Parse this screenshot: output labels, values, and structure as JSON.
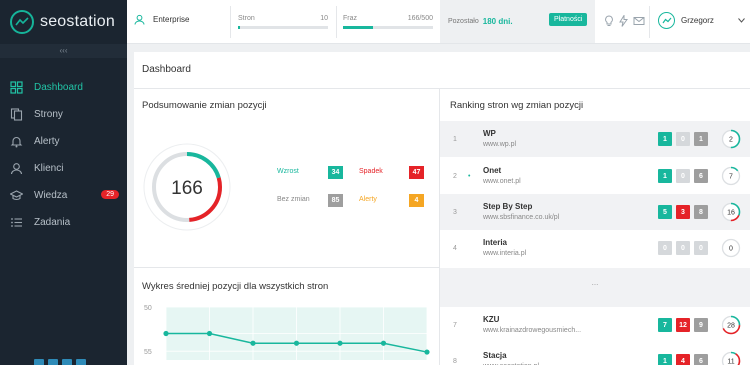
{
  "app": {
    "name": "seostation"
  },
  "sidebar": {
    "collapse_label": "‹‹‹",
    "items": [
      {
        "label": "Dashboard",
        "icon": "dashboard-icon",
        "active": true
      },
      {
        "label": "Strony",
        "icon": "pages-icon"
      },
      {
        "label": "Alerty",
        "icon": "bell-icon"
      },
      {
        "label": "Klienci",
        "icon": "user-icon"
      },
      {
        "label": "Wiedza",
        "icon": "graduation-cap-icon",
        "badge": "29"
      },
      {
        "label": "Zadania",
        "icon": "list-icon"
      }
    ]
  },
  "topbar": {
    "plan": "Enterprise",
    "pages": {
      "label": "Stron",
      "value": "10",
      "fill": 0.02
    },
    "phrases": {
      "label": "Fraz",
      "value": "166/500",
      "fill": 0.33
    },
    "remaining_label": "Pozostało",
    "remaining_value": "180 dni.",
    "pay_button": "Płatności",
    "user": "Grzegorz"
  },
  "page": {
    "title": "Dashboard"
  },
  "summary": {
    "title": "Podsumowanie zmian pozycji",
    "total": "166",
    "stats": [
      {
        "label": "Wzrost",
        "value": "34",
        "color": "#18b79d",
        "labelColor": "#18b79d"
      },
      {
        "label": "Spadek",
        "value": "47",
        "color": "#e52328",
        "labelColor": "#e52328"
      },
      {
        "label": "Bez zmian",
        "value": "85",
        "color": "#9e9e9e",
        "labelColor": "#888888"
      },
      {
        "label": "Alerty",
        "value": "4",
        "color": "#f5a623",
        "labelColor": "#f5a623"
      }
    ]
  },
  "avg_chart": {
    "title": "Wykres średniej pozycji dla wszystkich stron"
  },
  "chart_data": {
    "type": "line",
    "title": "Wykres średniej pozycji dla wszystkich stron",
    "ytick_labels": [
      "50",
      "55"
    ],
    "ylim": [
      50,
      56
    ],
    "y_inverted": false,
    "values": [
      53.0,
      53.0,
      54.1,
      54.1,
      54.1,
      54.1,
      55.1
    ],
    "grid": true
  },
  "ranking": {
    "title": "Ranking stron wg zmian pozycji",
    "ellipsis": "...",
    "rows": [
      {
        "num": "1",
        "dot": "",
        "name": "WP",
        "url": "www.wp.pl",
        "up": "1",
        "down": "0",
        "same": "1",
        "total": "2",
        "shaded": true
      },
      {
        "num": "2",
        "dot": "•",
        "name": "Onet",
        "url": "www.onet.pl",
        "up": "1",
        "down": "0",
        "same": "6",
        "total": "7",
        "shaded": false
      },
      {
        "num": "3",
        "dot": "",
        "name": "Step By Step",
        "url": "www.sbsfinance.co.uk/pl",
        "up": "5",
        "down": "3",
        "same": "8",
        "total": "16",
        "shaded": true
      },
      {
        "num": "4",
        "dot": "",
        "name": "Interia",
        "url": "www.interia.pl",
        "up": "0",
        "down": "0",
        "same": "0",
        "total": "0",
        "shaded": false
      },
      {
        "num": "7",
        "dot": "",
        "name": "KZU",
        "url": "www.krainazdrowegousmiech...",
        "up": "7",
        "down": "12",
        "same": "9",
        "total": "28",
        "shaded": false
      },
      {
        "num": "8",
        "dot": "",
        "name": "Stacja",
        "url": "www.seostation.pl",
        "up": "1",
        "down": "4",
        "same": "6",
        "total": "11",
        "shaded": false
      }
    ]
  },
  "colors": {
    "accent": "#18b79d",
    "danger": "#e52328",
    "neutral": "#9e9e9e",
    "warning": "#f5a623",
    "sidebar": "#1b2530"
  }
}
